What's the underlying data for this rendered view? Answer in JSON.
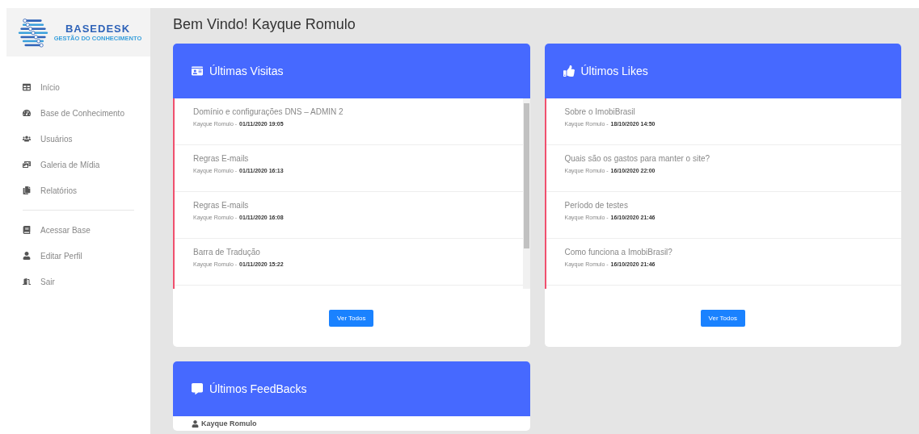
{
  "logo": {
    "name": "BASEDESK",
    "tagline": "GESTÃO DO CONHECIMENTO"
  },
  "sidebar": {
    "groups": [
      [
        {
          "label": "Início"
        },
        {
          "label": "Base de Conhecimento"
        },
        {
          "label": "Usuários"
        },
        {
          "label": "Galeria de Mídia"
        },
        {
          "label": "Relatórios"
        }
      ],
      [
        {
          "label": "Acessar Base"
        },
        {
          "label": "Editar Perfil"
        },
        {
          "label": "Sair"
        }
      ]
    ]
  },
  "greeting": "Bem Vindo! Kayque Romulo",
  "cards": [
    {
      "title": "Últimas Visitas",
      "scrollbar": true,
      "button": "Ver Todos",
      "items": [
        {
          "title": "Domínio e configurações DNS – ADMIN 2",
          "author": "Kayque Romulo -",
          "date": "01/11/2020 19:05"
        },
        {
          "title": "Regras E-mails",
          "author": "Kayque Romulo -",
          "date": "01/11/2020 16:13"
        },
        {
          "title": "Regras E-mails",
          "author": "Kayque Romulo -",
          "date": "01/11/2020 16:08"
        },
        {
          "title": "Barra de Tradução",
          "author": "Kayque Romulo -",
          "date": "01/11/2020 15:22"
        }
      ]
    },
    {
      "title": "Últimos Likes",
      "scrollbar": false,
      "button": "Ver Todos",
      "items": [
        {
          "title": "Sobre o ImobiBrasil",
          "author": "Kayque Romulo -",
          "date": "18/10/2020 14:50"
        },
        {
          "title": "Quais são os gastos para manter o site?",
          "author": "Kayque Romulo -",
          "date": "16/10/2020 22:00"
        },
        {
          "title": "Período de testes",
          "author": "Kayque Romulo -",
          "date": "16/10/2020 21:46"
        },
        {
          "title": "Como funciona a ImobiBrasil?",
          "author": "Kayque Romulo -",
          "date": "16/10/2020 21:46"
        }
      ]
    }
  ],
  "feedbacks": {
    "title": "Últimos FeedBacks",
    "first_author": "Kayque Romulo"
  }
}
